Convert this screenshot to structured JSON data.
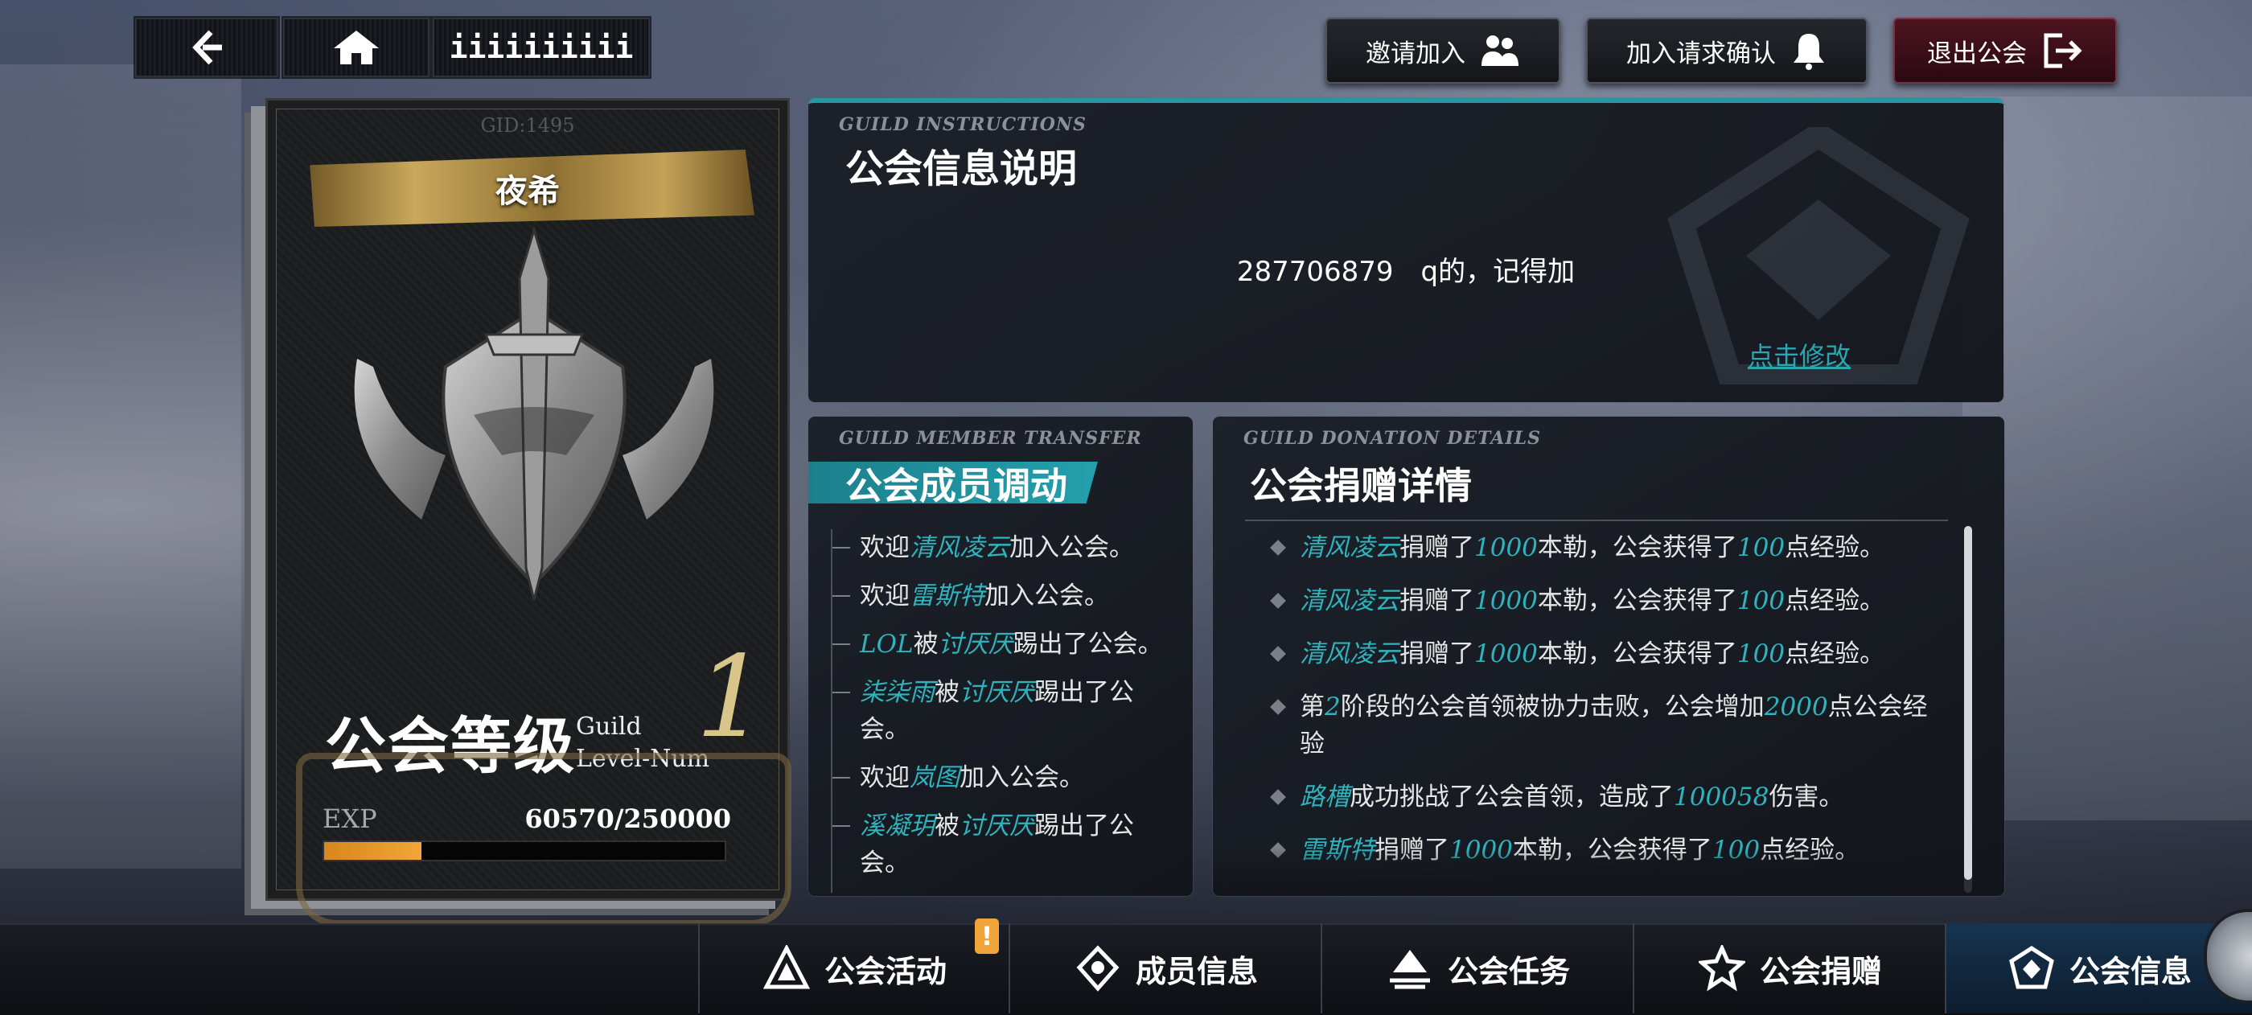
{
  "nav": {
    "page_indicator": "iiiiiiiiii"
  },
  "actions": {
    "invite": "邀请加入",
    "confirm_requests": "加入请求确认",
    "quit": "退出公会"
  },
  "guild_card": {
    "gid": "GID:1495",
    "name": "夜希",
    "level_title": "公会等级",
    "level_en_1": "Guild",
    "level_en_2": "Level-Num",
    "level": "1",
    "exp_label": "EXP",
    "exp_value": "60570/250000",
    "exp_progress": 0.2423
  },
  "instructions": {
    "en_title": "GUILD INSTRUCTIONS",
    "title": "公会信息说明",
    "text": "287706879　q的，记得加",
    "edit": "点击修改"
  },
  "transfer": {
    "en_title": "GUILD MEMBER TRANSFER",
    "title": "公会成员调动",
    "items": [
      {
        "pre": "欢迎",
        "name1": "清风凌云",
        "mid": "",
        "name2": "",
        "post": "加入公会。"
      },
      {
        "pre": "欢迎",
        "name1": "雷斯特",
        "mid": "",
        "name2": "",
        "post": "加入公会。"
      },
      {
        "pre": "",
        "name1": "LOL",
        "mid": "被",
        "name2": "讨厌厌",
        "post": "踢出了公会。"
      },
      {
        "pre": "",
        "name1": "柒柒雨",
        "mid": "被",
        "name2": "讨厌厌",
        "post": "踢出了公会。"
      },
      {
        "pre": "欢迎",
        "name1": "岚图",
        "mid": "",
        "name2": "",
        "post": "加入公会。"
      },
      {
        "pre": "",
        "name1": "溪凝玥",
        "mid": "被",
        "name2": "讨厌厌",
        "post": "踢出了公会。"
      }
    ]
  },
  "donation": {
    "en_title": "GUILD DONATION DETAILS",
    "title": "公会捐赠详情",
    "items": [
      {
        "a": "清风凌云",
        "b": "捐赠了",
        "c": "1000",
        "d": "本勒，公会获得了",
        "e": "100",
        "f": "点经验。"
      },
      {
        "a": "清风凌云",
        "b": "捐赠了",
        "c": "1000",
        "d": "本勒，公会获得了",
        "e": "100",
        "f": "点经验。"
      },
      {
        "a": "清风凌云",
        "b": "捐赠了",
        "c": "1000",
        "d": "本勒，公会获得了",
        "e": "100",
        "f": "点经验。"
      },
      {
        "a": "",
        "b": "第",
        "c": "2",
        "d": "阶段的公会首领被协力击败，公会增加",
        "e": "2000",
        "f": "点公会经验"
      },
      {
        "a": "路槽",
        "b": "成功挑战了公会首领，造成了",
        "c": "100058",
        "d": "伤害。",
        "e": "",
        "f": ""
      },
      {
        "a": "雷斯特",
        "b": "捐赠了",
        "c": "1000",
        "d": "本勒，公会获得了",
        "e": "100",
        "f": "点经验。"
      }
    ]
  },
  "tabs": [
    {
      "label": "公会活动"
    },
    {
      "label": "成员信息"
    },
    {
      "label": "公会任务"
    },
    {
      "label": "公会捐赠"
    },
    {
      "label": "公会信息"
    }
  ],
  "badge": "!",
  "colors": {
    "accent_teal": "#2fb3bd",
    "exp_orange": "#f2a637",
    "quit_red": "#4d1420"
  }
}
